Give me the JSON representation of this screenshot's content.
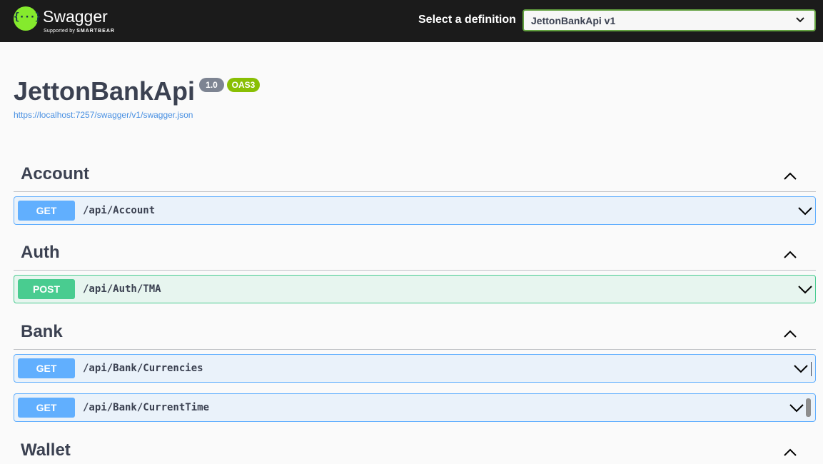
{
  "header": {
    "logo_glyph": "{···}",
    "brand_name": "Swagger",
    "brand_tagline_prefix": "Supported by",
    "brand_tagline_company": "SMARTBEAR",
    "definition_label": "Select a definition",
    "definition_selected": "JettonBankApi v1",
    "logo_color": "#85ea2d",
    "bar_color": "#1b1b1b"
  },
  "info": {
    "title": "JettonBankApi",
    "version": "1.0",
    "oas_badge": "OAS3",
    "spec_url": "https://localhost:7257/swagger/v1/swagger.json"
  },
  "tags": [
    {
      "name": "Account",
      "operations": [
        {
          "method": "GET",
          "path": "/api/Account"
        }
      ]
    },
    {
      "name": "Auth",
      "operations": [
        {
          "method": "POST",
          "path": "/api/Auth/TMA"
        }
      ]
    },
    {
      "name": "Bank",
      "operations": [
        {
          "method": "GET",
          "path": "/api/Bank/Currencies"
        },
        {
          "method": "GET",
          "path": "/api/Bank/CurrentTime"
        }
      ]
    },
    {
      "name": "Wallet",
      "operations": []
    }
  ],
  "colors": {
    "get": "#61affe",
    "post": "#49cc90",
    "link": "#4990e2",
    "oas_badge": "#89bf04",
    "version_badge": "#7d8492"
  }
}
